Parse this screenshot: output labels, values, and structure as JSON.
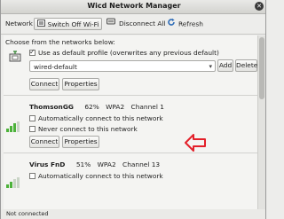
{
  "window": {
    "title": "Wicd Network Manager",
    "close_symbol": "✕"
  },
  "toolbar": {
    "network_label": "Network",
    "switch_off_wifi": "Switch Off Wi-Fi",
    "disconnect_all": "Disconnect All",
    "refresh": "Refresh"
  },
  "wired": {
    "choose_label": "Choose from the networks below:",
    "use_default_label": "Use as default profile (overwrites any previous default)",
    "use_default_checked": true,
    "profile_value": "wired-default",
    "add_label": "Add",
    "delete_label": "Delete",
    "connect_label": "Connect",
    "properties_label": "Properties"
  },
  "networks": [
    {
      "ssid": "ThomsonGG",
      "strength": "62%",
      "security": "WPA2",
      "channel": "Channel 1",
      "signal_level": 0.62,
      "auto_connect_label": "Automatically connect to this network",
      "never_connect_label": "Never connect to this network",
      "connect_label": "Connect",
      "properties_label": "Properties"
    },
    {
      "ssid": "Virus FnD",
      "strength": "51%",
      "security": "WPA2",
      "channel": "Channel 13",
      "signal_level": 0.51,
      "auto_connect_label": "Automatically connect to this network"
    }
  ],
  "status": {
    "text": "Not connected"
  },
  "colors": {
    "signal": "#4cb23a",
    "arrow": "#e3202a"
  }
}
